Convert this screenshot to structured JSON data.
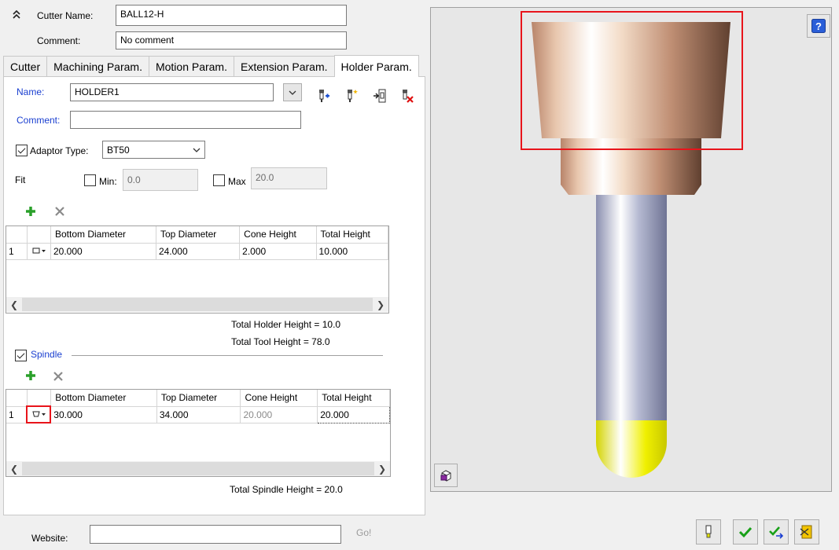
{
  "header": {
    "cutter_name_label": "Cutter Name:",
    "cutter_name_value": "BALL12-H",
    "comment_label": "Comment:",
    "comment_value": "No comment"
  },
  "tabs": [
    {
      "label": "Cutter"
    },
    {
      "label": "Machining Param."
    },
    {
      "label": "Motion Param."
    },
    {
      "label": "Extension Param."
    },
    {
      "label": "Holder Param.",
      "active": true
    }
  ],
  "holder": {
    "name_label": "Name:",
    "name_value": "HOLDER1",
    "comment_label": "Comment:",
    "comment_value": "",
    "adaptor_type_label": "Adaptor Type:",
    "adaptor_type_checked": true,
    "adaptor_type_value": "BT50",
    "fit_label": "Fit",
    "min_label": "Min:",
    "min_value": "0.0",
    "max_label": "Max",
    "max_value": "20.0",
    "columns": [
      "Bottom Diameter",
      "Top Diameter",
      "Cone Height",
      "Total Height"
    ],
    "rows": [
      {
        "index": "1",
        "bottom": "20.000",
        "top": "24.000",
        "cone": "2.000",
        "total": "10.000"
      }
    ],
    "total_holder_height": "Total Holder Height = 10.0",
    "total_tool_height": "Total Tool Height = 78.0"
  },
  "spindle": {
    "label": "Spindle",
    "checked": true,
    "columns": [
      "Bottom Diameter",
      "Top Diameter",
      "Cone Height",
      "Total Height"
    ],
    "rows": [
      {
        "index": "1",
        "bottom": "30.000",
        "top": "34.000",
        "cone": "20.000",
        "total": "20.000"
      }
    ],
    "total_spindle_height": "Total Spindle Height = 20.0"
  },
  "footer": {
    "website_label": "Website:",
    "website_value": "",
    "go_label": "Go!"
  },
  "colors": {
    "highlight_red": "#e8141b",
    "label_blue": "#1a3fd0",
    "holder_copper": "#c99a7e",
    "shank_steel": "#9ea3bd",
    "ball_yellow": "#e8e800"
  },
  "icons": {
    "collapse": "double-chevron-up-icon",
    "help": "help-icon",
    "add": "plus-icon",
    "delete": "x-icon",
    "view_cube": "view-cube-icon",
    "ok": "checkmark-icon"
  }
}
